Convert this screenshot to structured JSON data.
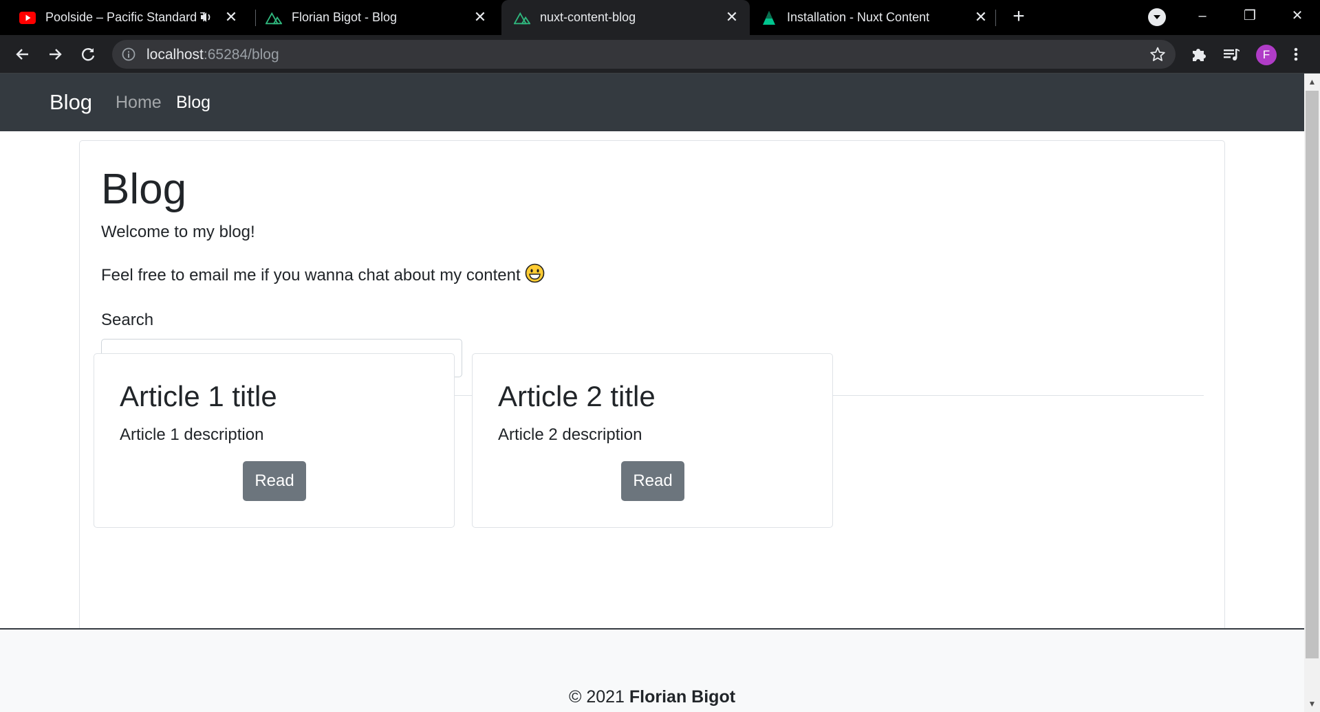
{
  "browser": {
    "tabs": [
      {
        "title": "Poolside – Pacific Standard Ti",
        "favicon": "youtube-icon",
        "audio": true
      },
      {
        "title": "Florian Bigot - Blog",
        "favicon": "nuxt-icon"
      },
      {
        "title": "nuxt-content-blog",
        "favicon": "nuxt-icon",
        "active": true
      },
      {
        "title": "Installation - Nuxt Content",
        "favicon": "nuxt-content-icon"
      }
    ],
    "close_glyph": "✕",
    "newtab_glyph": "+",
    "url_host": "localhost",
    "url_rest": ":65284/blog",
    "avatar_letter": "F",
    "window_minimize": "–",
    "window_restore": "❐",
    "window_close": "✕"
  },
  "site": {
    "brand": "Blog",
    "nav": {
      "home": "Home",
      "blog": "Blog"
    }
  },
  "main": {
    "heading": "Blog",
    "intro": "Welcome to my blog!",
    "contact": "Feel free to email me if you wanna chat about my content",
    "search_label": "Search",
    "search_value": "",
    "articles": [
      {
        "title": "Article 1 title",
        "description": "Article 1 description",
        "button": "Read"
      },
      {
        "title": "Article 2 title",
        "description": "Article 2 description",
        "button": "Read"
      }
    ]
  },
  "footer": {
    "prefix": "© 2021 ",
    "name": "Florian Bigot"
  },
  "colors": {
    "navbar": "#343a40",
    "button_secondary": "#6c757d",
    "avatar": "#b03cc7"
  }
}
